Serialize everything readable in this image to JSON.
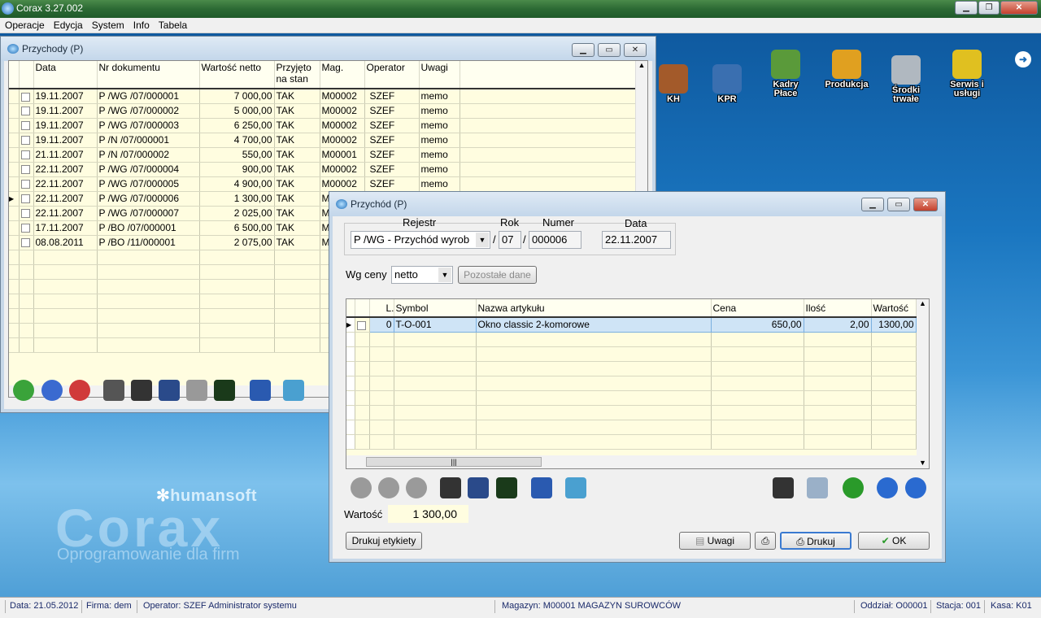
{
  "app": {
    "title": "Corax 3.27.002"
  },
  "menu": [
    "Operacje",
    "Edycja",
    "System",
    "Info",
    "Tabela"
  ],
  "desktop": {
    "icons": [
      {
        "label": "KH",
        "icon": "book-icon",
        "color": "#a35a2a"
      },
      {
        "label": "KPR",
        "icon": "ledger-add-icon",
        "color": "#3a6fb0"
      },
      {
        "label": "Kadry Płace",
        "icon": "money-hand-icon",
        "color": "#5a9a3a"
      },
      {
        "label": "Produkcja",
        "icon": "worker-icon",
        "color": "#e0a020"
      },
      {
        "label": "Środki trwałe",
        "icon": "truck-icon",
        "color": "#b0b8c0"
      },
      {
        "label": "Serwis i usługi",
        "icon": "drill-icon",
        "color": "#e0c020"
      }
    ],
    "logo": {
      "brand": "humansoft",
      "product": "Corax",
      "tagline": "Oprogramowanie dla firm"
    }
  },
  "przychody": {
    "title": "Przychody (P)",
    "columns": [
      "Data",
      "Nr dokumentu",
      "Wartość netto",
      "Przyjęto na stan",
      "Mag.",
      "Operator",
      "Uwagi"
    ],
    "rows": [
      [
        "19.11.2007",
        "P /WG /07/000001",
        "7 000,00",
        "TAK",
        "M00002",
        "SZEF",
        "memo"
      ],
      [
        "19.11.2007",
        "P /WG /07/000002",
        "5 000,00",
        "TAK",
        "M00002",
        "SZEF",
        "memo"
      ],
      [
        "19.11.2007",
        "P /WG /07/000003",
        "6 250,00",
        "TAK",
        "M00002",
        "SZEF",
        "memo"
      ],
      [
        "19.11.2007",
        "P /N  /07/000001",
        "4 700,00",
        "TAK",
        "M00002",
        "SZEF",
        "memo"
      ],
      [
        "21.11.2007",
        "P /N  /07/000002",
        "550,00",
        "TAK",
        "M00001",
        "SZEF",
        "memo"
      ],
      [
        "22.11.2007",
        "P /WG /07/000004",
        "900,00",
        "TAK",
        "M00002",
        "SZEF",
        "memo"
      ],
      [
        "22.11.2007",
        "P /WG /07/000005",
        "4 900,00",
        "TAK",
        "M00002",
        "SZEF",
        "memo"
      ],
      [
        "22.11.2007",
        "P /WG /07/000006",
        "1 300,00",
        "TAK",
        "M",
        "",
        ""
      ],
      [
        "22.11.2007",
        "P /WG /07/000007",
        "2 025,00",
        "TAK",
        "M",
        "",
        ""
      ],
      [
        "17.11.2007",
        "P /BO /07/000001",
        "6 500,00",
        "TAK",
        "M",
        "",
        ""
      ],
      [
        "08.08.2011",
        "P /BO /11/000001",
        "2 075,00",
        "TAK",
        "M",
        "",
        ""
      ]
    ],
    "current_row": 7
  },
  "przychod": {
    "title": "Przychód (P)",
    "labels": {
      "rejestr": "Rejestr",
      "rok": "Rok",
      "numer": "Numer",
      "data": "Data",
      "wg_ceny": "Wg ceny",
      "wartosc": "Wartość"
    },
    "rejestr": "P /WG  - Przychód wyrob",
    "rok": "07",
    "numer": "000006",
    "data": "22.11.2007",
    "wg_ceny": "netto",
    "pozostale": "Pozostałe dane",
    "columns": [
      "L.p.",
      "Symbol",
      "Nazwa artykułu",
      "Cena",
      "Ilość",
      "Wartość"
    ],
    "items": [
      [
        "0",
        "T-O-001",
        "Okno classic 2-komorowe",
        "650,00",
        "2,00",
        "1300,00"
      ]
    ],
    "wartosc": "1 300,00",
    "buttons": {
      "drukuj_etykiety": "Drukuj etykiety",
      "uwagi": "Uwagi",
      "drukuj": "Drukuj",
      "ok": "OK"
    }
  },
  "status": {
    "data": "Data: 21.05.2012",
    "firma": "Firma: dem",
    "operator": "Operator: SZEF Administrator systemu",
    "magazyn": "Magazyn: M00001 MAGAZYN SUROWCÓW",
    "oddzial": "Oddział: O00001",
    "stacja": "Stacja: 001",
    "kasa": "Kasa: K01"
  }
}
